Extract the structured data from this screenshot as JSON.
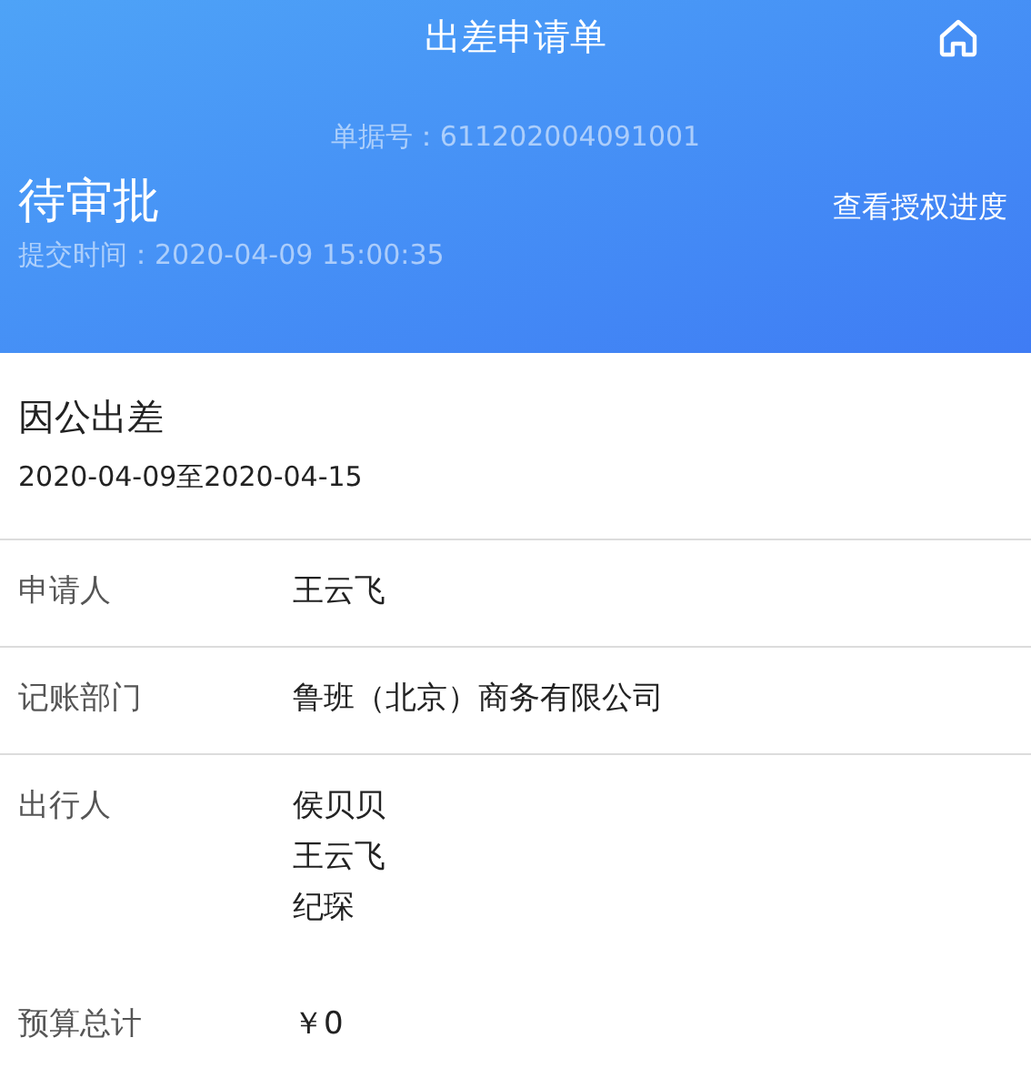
{
  "header": {
    "title": "出差申请单",
    "document_number": "单据号：611202004091001",
    "status": "待审批",
    "progress_link": "查看授权进度",
    "submitted": "提交时间：2020-04-09 15:00:35"
  },
  "trip": {
    "type": "因公出差",
    "dates": "2020-04-09至2020-04-15"
  },
  "fields": [
    {
      "label": "申请人",
      "values": [
        "王云飞"
      ],
      "divider": true
    },
    {
      "label": "记账部门",
      "values": [
        "鲁班（北京）商务有限公司"
      ],
      "divider": true
    },
    {
      "label": "出行人",
      "values": [
        "侯贝贝",
        "王云飞",
        "纪琛"
      ],
      "divider": false
    },
    {
      "label": "预算总计",
      "values": [
        "￥0"
      ],
      "divider": false
    }
  ]
}
